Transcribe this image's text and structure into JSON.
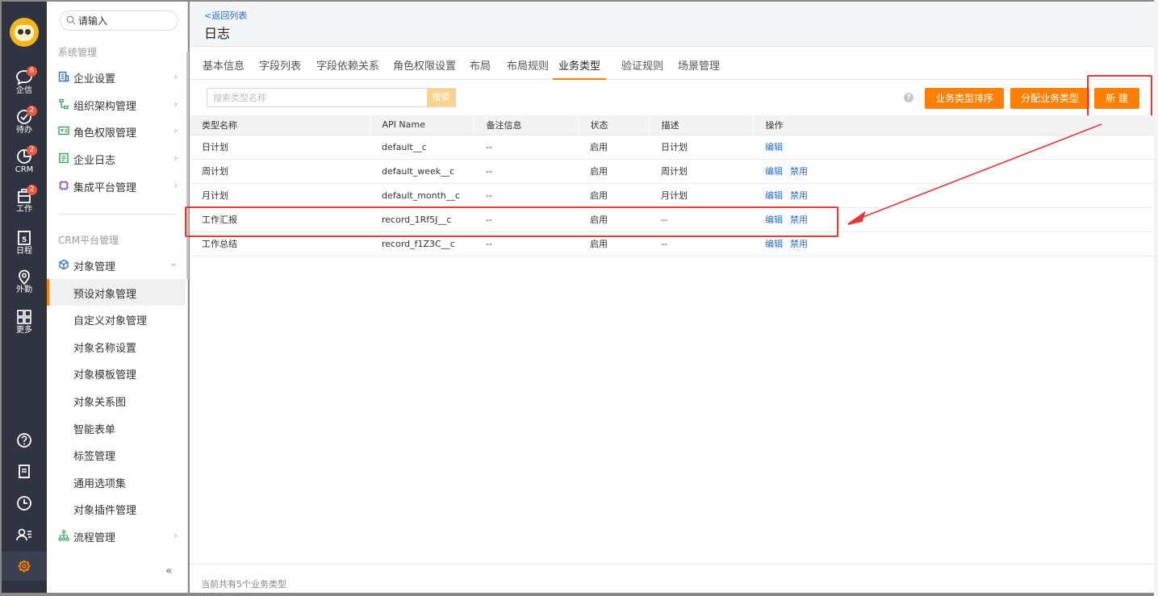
{
  "rail": {
    "items": [
      {
        "label": "企信",
        "badge": "6"
      },
      {
        "label": "待办",
        "badge": "2"
      },
      {
        "label": "CRM",
        "badge": "2"
      },
      {
        "label": "工作",
        "badge": "2"
      },
      {
        "label": "日程",
        "badge": ""
      },
      {
        "label": "外勤",
        "badge": ""
      },
      {
        "label": "更多",
        "badge": ""
      }
    ],
    "calendar_day": "5"
  },
  "sidebar": {
    "search_placeholder": "请输入",
    "section1": "系统管理",
    "items1": [
      "企业设置",
      "组织架构管理",
      "角色权限管理",
      "企业日志",
      "集成平台管理"
    ],
    "section2": "CRM平台管理",
    "object_mgmt": "对象管理",
    "subitems": [
      "预设对象管理",
      "自定义对象管理",
      "对象名称设置",
      "对象模板管理",
      "对象关系图",
      "智能表单",
      "标签管理",
      "通用选项集",
      "对象插件管理"
    ],
    "flow_mgmt": "流程管理",
    "collapse": "«"
  },
  "header": {
    "back": "<返回列表",
    "title": "日志"
  },
  "tabs": [
    "基本信息",
    "字段列表",
    "字段依赖关系",
    "角色权限设置",
    "布局",
    "布局规则",
    "业务类型",
    "验证规则",
    "场景管理"
  ],
  "toolbar": {
    "search_placeholder": "搜索类型名称",
    "search_btn": "搜索",
    "sort_btn": "业务类型排序",
    "assign_btn": "分配业务类型",
    "new_btn": "新 建"
  },
  "table": {
    "columns": [
      "类型名称",
      "API Name",
      "备注信息",
      "状态",
      "描述",
      "操作"
    ],
    "rows": [
      {
        "name": "日计划",
        "api": "default__c",
        "note": "--",
        "status": "启用",
        "desc": "日计划",
        "edit": "编辑",
        "disable": ""
      },
      {
        "name": "周计划",
        "api": "default_week__c",
        "note": "--",
        "status": "启用",
        "desc": "周计划",
        "edit": "编辑",
        "disable": "禁用"
      },
      {
        "name": "月计划",
        "api": "default_month__c",
        "note": "--",
        "status": "启用",
        "desc": "月计划",
        "edit": "编辑",
        "disable": "禁用"
      },
      {
        "name": "工作汇报",
        "api": "record_1Rf5J__c",
        "note": "--",
        "status": "启用",
        "desc": "--",
        "edit": "编辑",
        "disable": "禁用"
      },
      {
        "name": "工作总结",
        "api": "record_f1Z3C__c",
        "note": "--",
        "status": "启用",
        "desc": "--",
        "edit": "编辑",
        "disable": "禁用"
      }
    ]
  },
  "footer": "当前共有5个业务类型",
  "colors": {
    "accent": "#ff8000",
    "link": "#2a6dc6",
    "rail": "#2f3440",
    "annotation": "#e53935"
  }
}
